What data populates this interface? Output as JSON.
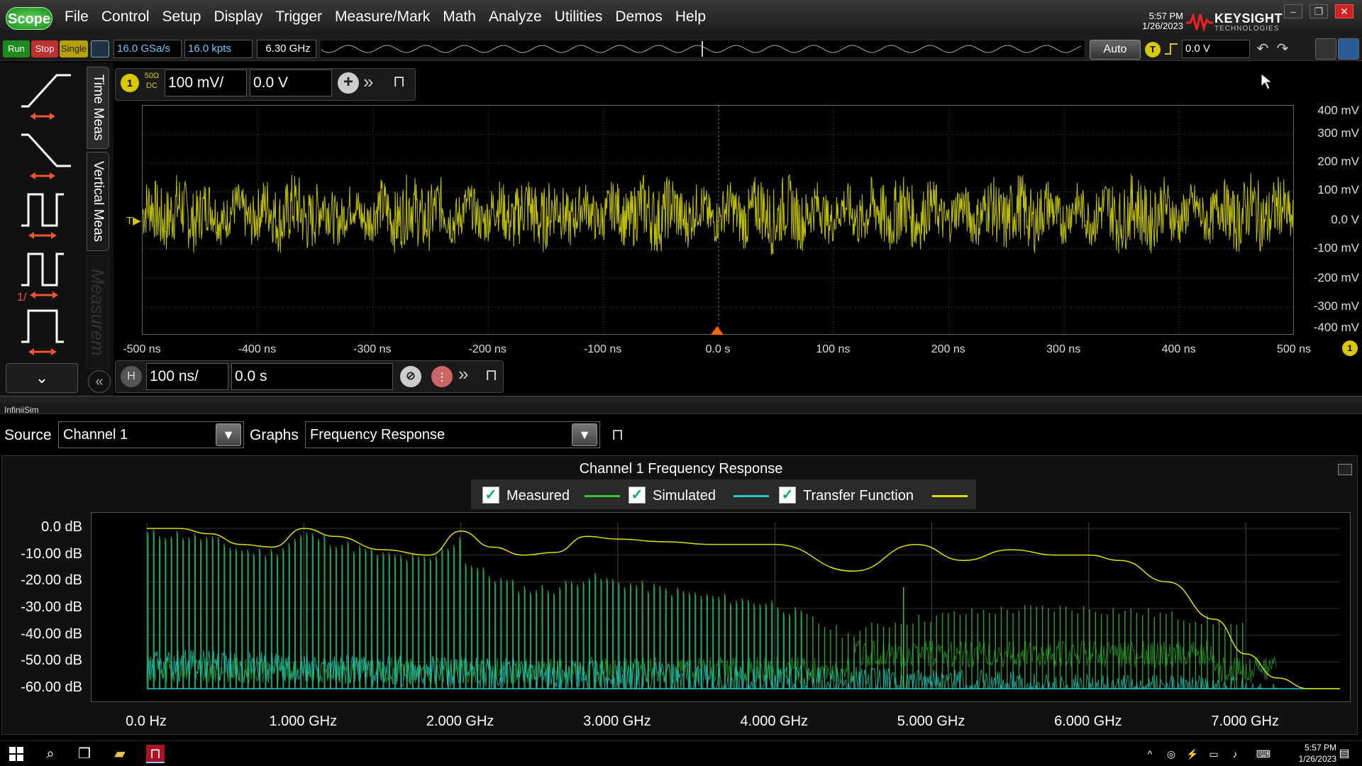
{
  "menubar": {
    "logo": "Scope",
    "items": [
      "File",
      "Control",
      "Setup",
      "Display",
      "Trigger",
      "Measure/Mark",
      "Math",
      "Analyze",
      "Utilities",
      "Demos",
      "Help"
    ],
    "clock_time": "5:57 PM",
    "clock_date": "1/26/2023",
    "brand": "KEYSIGHT",
    "brand_sub": "TECHNOLOGIES"
  },
  "toolbar": {
    "run": "Run",
    "stop": "Stop",
    "single": "Single",
    "sample_rate": "16.0 GSa/s",
    "memory_depth": "16.0 kpts",
    "bandwidth": "6.30 GHz",
    "auto": "Auto",
    "trigger_badge": "T",
    "trigger_level": "0.0 V"
  },
  "left_panel": {
    "tabs": [
      "Time Meas",
      "Vertical Meas",
      "Measurem"
    ]
  },
  "channel": {
    "number": "1",
    "impedance": "50Ω",
    "coupling": "DC",
    "scale": "100 mV/",
    "offset": "0.0 V"
  },
  "waveform": {
    "y_labels": [
      "400 mV",
      "300 mV",
      "200 mV",
      "100 mV",
      "0.0 V",
      "-100 mV",
      "-200 mV",
      "-300 mV",
      "-400 mV"
    ],
    "x_labels": [
      "-500 ns",
      "-400 ns",
      "-300 ns",
      "-200 ns",
      "-100 ns",
      "0.0 s",
      "100 ns",
      "200 ns",
      "300 ns",
      "400 ns",
      "500 ns"
    ],
    "trace_color": "#e0e000"
  },
  "horizontal": {
    "badge": "H",
    "scale": "100 ns/",
    "position": "0.0 s"
  },
  "infinisim": {
    "panel_title": "InfiniiSim",
    "source_label": "Source",
    "source_value": "Channel 1",
    "graphs_label": "Graphs",
    "graphs_value": "Frequency Response"
  },
  "chart_data": {
    "type": "line",
    "title": "Channel 1 Frequency Response",
    "xlabel": "",
    "ylabel": "",
    "x_tick_labels": [
      "0.0 Hz",
      "1.000 GHz",
      "2.000 GHz",
      "3.000 GHz",
      "4.000 GHz",
      "5.000 GHz",
      "6.000 GHz",
      "7.000 GHz"
    ],
    "y_tick_labels": [
      "0.0 dB",
      "-10.00 dB",
      "-20.00 dB",
      "-30.00 dB",
      "-40.00 dB",
      "-50.00 dB",
      "-60.00 dB"
    ],
    "xlim": [
      0,
      7.6
    ],
    "ylim": [
      -60,
      0
    ],
    "x_unit": "GHz",
    "legend": "top-center",
    "series": [
      {
        "name": "Measured",
        "color": "#33cc33"
      },
      {
        "name": "Simulated",
        "color": "#22cccc"
      },
      {
        "name": "Transfer Function",
        "color": "#e0e000",
        "x": [
          0.0,
          0.2,
          0.4,
          0.6,
          0.8,
          1.0,
          1.2,
          1.5,
          1.8,
          2.0,
          2.2,
          2.4,
          2.6,
          2.8,
          3.0,
          3.3,
          3.6,
          4.0,
          4.5,
          4.9,
          5.2,
          5.5,
          5.8,
          6.0,
          6.2,
          6.5,
          6.8,
          7.0,
          7.2,
          7.4,
          7.6
        ],
        "y": [
          0,
          0,
          -2,
          -6,
          -7,
          0,
          -3,
          -8,
          -10,
          -1,
          -7,
          -10,
          -9,
          -3,
          -4,
          -5,
          -6,
          -6,
          -16,
          -6,
          -12,
          -8,
          -10,
          -10,
          -12,
          -20,
          -34,
          -47,
          -56,
          -60,
          -60
        ]
      }
    ]
  },
  "taskbar": {
    "time": "5:57 PM",
    "date": "1/26/2023"
  }
}
